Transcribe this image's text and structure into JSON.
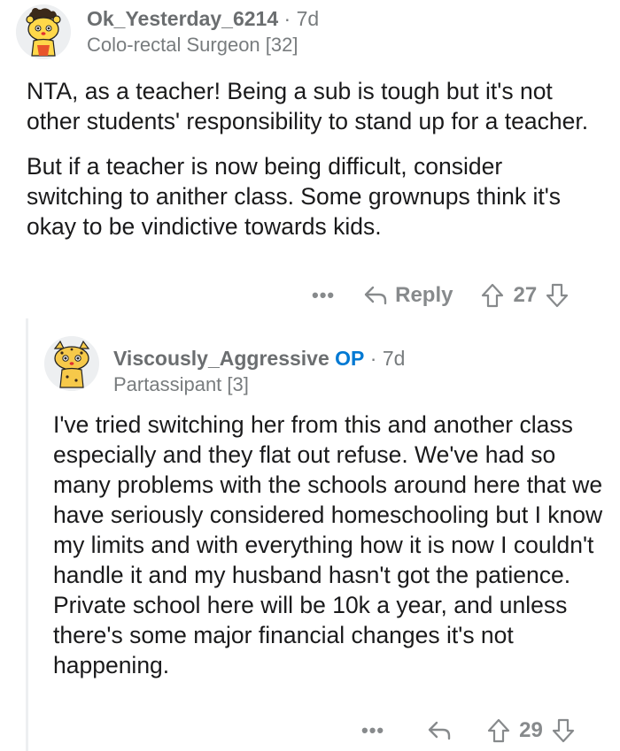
{
  "comments": [
    {
      "username": "Ok_Yesterday_6214",
      "separator": "·",
      "age": "7d",
      "flair": "Colo-rectal Surgeon [32]",
      "paragraphs": [
        "NTA, as a teacher! Being a sub is tough but it's not other students' responsibility to stand up for a teacher.",
        "But if a teacher is now being difficult, consider switching to anither class. Some grownups think it's okay to be vindictive towards kids."
      ],
      "more_label": "•••",
      "reply_label": "Reply",
      "score": "27",
      "icons": [
        "avatar-cat",
        "reply-arrow-icon",
        "upvote-arrow-icon",
        "downvote-arrow-icon"
      ]
    },
    {
      "username": "Viscously_Aggressive",
      "op_badge": "OP",
      "separator": "·",
      "age": "7d",
      "flair": "Partassipant [3]",
      "paragraphs": [
        "I've tried switching her from this and another class especially and they flat out refuse. We've had so many problems with the schools around here that we have seriously considered homeschooling but I know my limits and with everything how it is now I couldn't handle it and my husband hasn't got the patience. Private school here will be 10k a year, and unless there's some major financial changes it's not happening."
      ],
      "more_label": "•••",
      "score": "29",
      "icons": [
        "avatar-cheetah",
        "reply-arrow-icon",
        "upvote-arrow-icon",
        "downvote-arrow-icon"
      ]
    }
  ],
  "colors": {
    "text": "#1a1a1b",
    "muted": "#787c7e",
    "op_badge": "#0079d3",
    "thread_line": "#edeff1"
  }
}
